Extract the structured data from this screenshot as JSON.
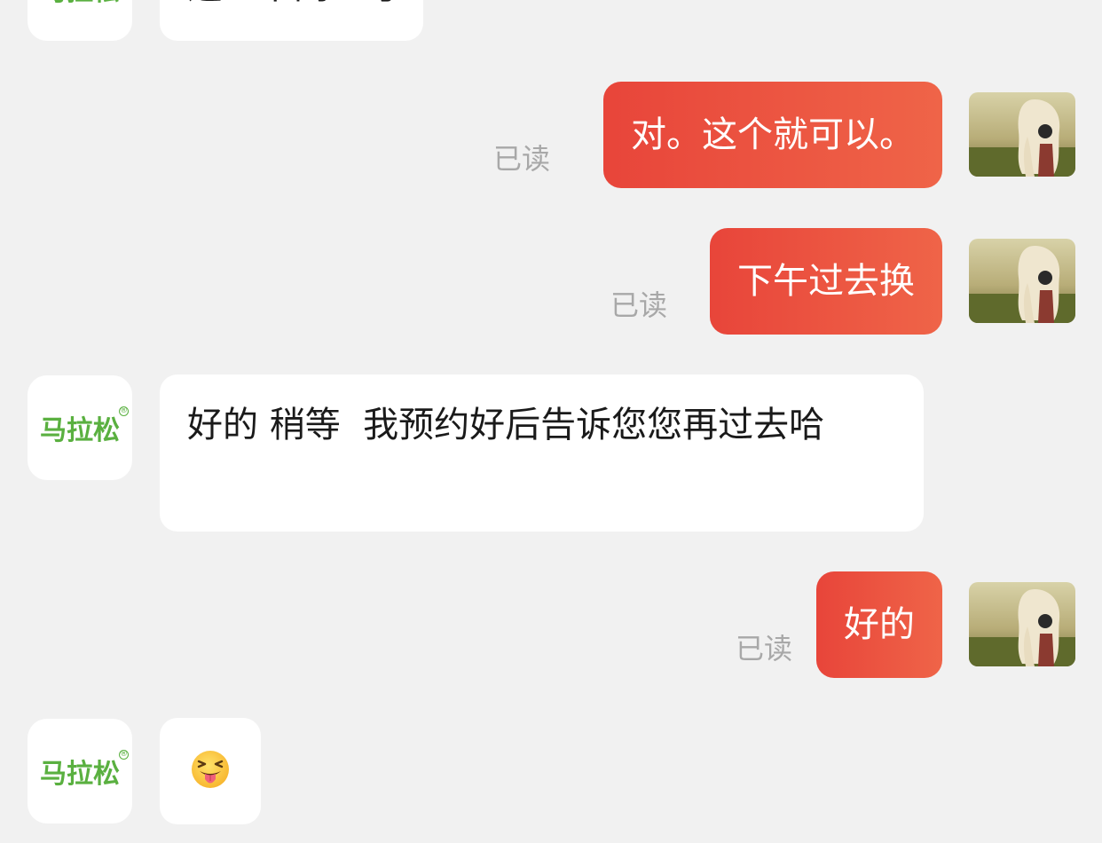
{
  "merchant": {
    "logo_text": "马拉松",
    "logo_mark": "®"
  },
  "messages": [
    {
      "from": "merchant",
      "text": "这一下同一号",
      "partial": true
    },
    {
      "from": "user",
      "text": "对。这个就可以。",
      "status": "已读"
    },
    {
      "from": "user",
      "text": "下午过去换",
      "status": "已读"
    },
    {
      "from": "merchant",
      "text": "好的 稍等  我预约好后告诉您您再过去哈"
    },
    {
      "from": "user",
      "text": "好的",
      "status": "已读"
    },
    {
      "from": "merchant",
      "emoji": "squinting-face-with-tongue-icon"
    }
  ],
  "colors": {
    "background": "#f1f1f1",
    "outgoing_start": "#e8453a",
    "outgoing_end": "#ef6448",
    "incoming": "#ffffff",
    "read_receipt": "#a8a8a8",
    "brand_green": "#5ab040"
  }
}
